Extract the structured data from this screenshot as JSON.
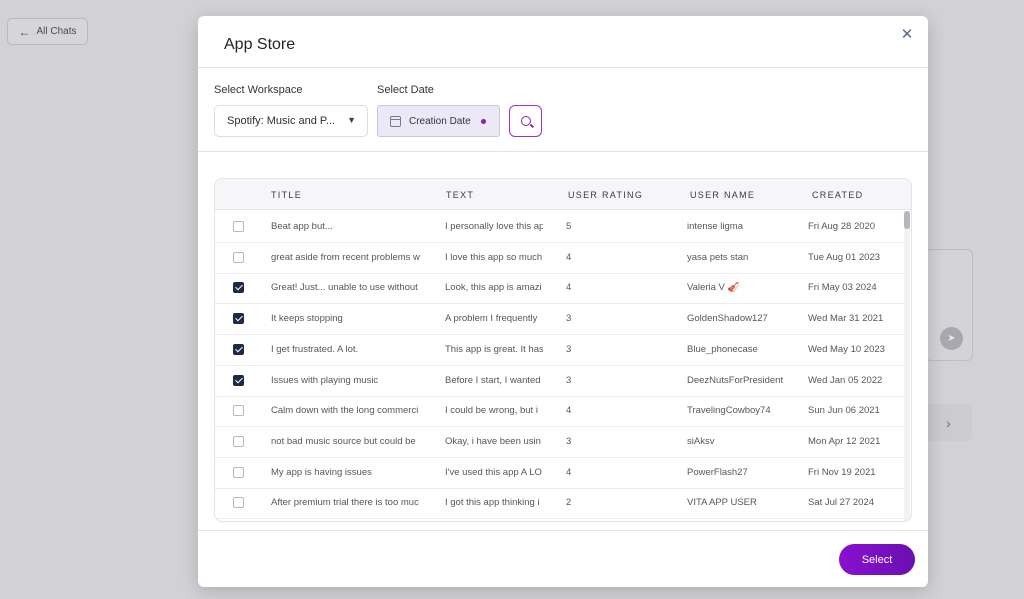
{
  "background": {
    "all_chats_label": "All Chats"
  },
  "modal": {
    "title": "App Store",
    "close_icon": "close-icon",
    "workspace_label": "Select Workspace",
    "workspace_value": "Spotify: Music and P...",
    "date_label": "Select Date",
    "date_value": "Creation Date",
    "select_button": "Select"
  },
  "table": {
    "headers": [
      "TITLE",
      "TEXT",
      "USER RATING",
      "USER NAME",
      "CREATED"
    ],
    "rows": [
      {
        "checked": false,
        "title": "Beat app but...",
        "text": "I personally love this ap",
        "rating": "5",
        "user": "intense ligma",
        "created": "Fri Aug 28 2020"
      },
      {
        "checked": false,
        "title": "great aside from recent problems w",
        "text": "I love this app so much",
        "rating": "4",
        "user": "yasa pets stan",
        "created": "Tue Aug 01 2023"
      },
      {
        "checked": true,
        "title": "Great! Just... unable to use without",
        "text": "Look, this app is amazi",
        "rating": "4",
        "user": "Valeria V 🎻",
        "created": "Fri May 03 2024"
      },
      {
        "checked": true,
        "title": "It keeps stopping",
        "text": "A problem I frequently",
        "rating": "3",
        "user": "GoldenShadow127",
        "created": "Wed Mar 31 2021"
      },
      {
        "checked": true,
        "title": "I get frustrated. A lot.",
        "text": "This app is great. It has",
        "rating": "3",
        "user": "Blue_phonecase",
        "created": "Wed May 10 2023"
      },
      {
        "checked": true,
        "title": "Issues with playing music",
        "text": "Before I start, I wanted",
        "rating": "3",
        "user": "DeezNutsForPresident",
        "created": "Wed Jan 05 2022"
      },
      {
        "checked": false,
        "title": "Calm down with the long commerci",
        "text": "I could be wrong, but i",
        "rating": "4",
        "user": "TravelingCowboy74",
        "created": "Sun Jun 06 2021"
      },
      {
        "checked": false,
        "title": "not bad music source but could be",
        "text": "Okay, i have been usin",
        "rating": "3",
        "user": "siAksv",
        "created": "Mon Apr 12 2021"
      },
      {
        "checked": false,
        "title": "My app is having issues",
        "text": "I've used this app A LO",
        "rating": "4",
        "user": "PowerFlash27",
        "created": "Fri Nov 19 2021"
      },
      {
        "checked": false,
        "title": "After premium trial there is too muc",
        "text": "I got this app thinking i",
        "rating": "2",
        "user": "VITA APP USER",
        "created": "Sat Jul 27 2024"
      }
    ]
  }
}
